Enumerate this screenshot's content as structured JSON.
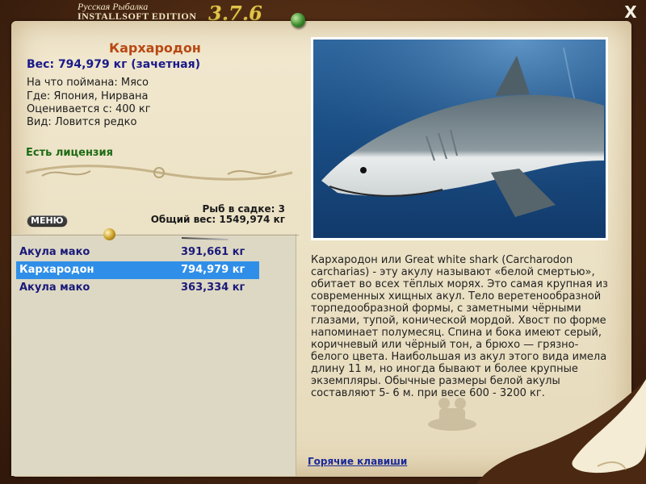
{
  "app": {
    "title_line1": "Русская Рыбалка",
    "title_line2": "INSTALLSOFT EDITION",
    "version": "3.7.6",
    "close_label": "X"
  },
  "fish": {
    "name": "Кархародон",
    "weight": "Вес: 794,979 кг (зачетная)",
    "caught_on": "На что поймана: Мясо",
    "where": "Где: Япония, Нирвана",
    "valued_from": "Оценивается с: 400 кг",
    "type": "Вид: Ловится редко",
    "license": "Есть лицензия"
  },
  "cage": {
    "count": "Рыб в садке: 3",
    "total": "Общий вес: 1549,974 кг"
  },
  "menu_label": "МЕНЮ",
  "catch_list": [
    {
      "name": "Акула мако",
      "weight": "391,661 кг"
    },
    {
      "name": "Кархародон",
      "weight": "794,979 кг"
    },
    {
      "name": "Акула мако",
      "weight": "363,334 кг"
    }
  ],
  "description": "Кархародон или Great white shark (Carcharodon carcharias) - эту акулу называют «белой смертью», обитает во всех тёплых морях. Это самая крупная из современных хищных акул. Тело веретенообразной торпедообразной формы, с заметными чёрными глазами, тупой, конической мордой. Хвост по форме напоминает полумесяц. Спина и бока имеют серый, коричневый или чёрный тон, а брюхо — грязно-белого цвета. Наибольшая из акул этого вида имела длину 11 м, но иногда бывают и более крупные экземпляры. Обычные размеры белой акулы составляют 5- 6 м. при весе 600 - 3200 кг.",
  "hotkeys_label": "Горячие клавиши",
  "colors": {
    "accent_name": "#b84812",
    "weight_text": "#1a1a8a",
    "license_text": "#1d6b14",
    "selection": "#2f8fe8"
  }
}
